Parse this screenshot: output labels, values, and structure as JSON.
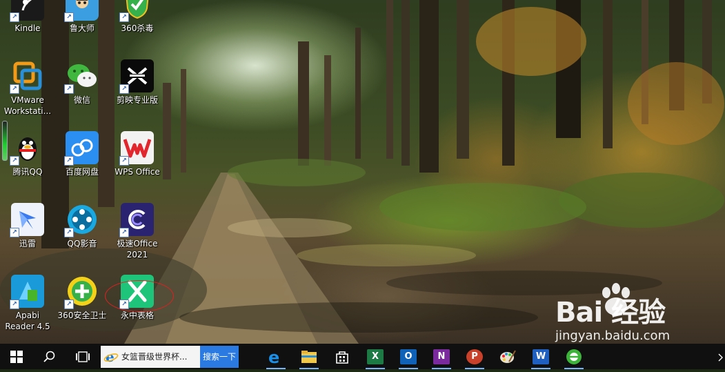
{
  "desktop": {
    "icons": [
      {
        "label": "Kindle"
      },
      {
        "label": "鲁大师"
      },
      {
        "label": "360杀毒"
      },
      {
        "label": "VMware Workstati..."
      },
      {
        "label": "微信"
      },
      {
        "label": "剪映专业版"
      },
      {
        "label": "腾讯QQ"
      },
      {
        "label": "百度网盘"
      },
      {
        "label": "WPS Office"
      },
      {
        "label": "迅雷"
      },
      {
        "label": "QQ影音"
      },
      {
        "label": "极速Office 2021"
      },
      {
        "label": "Apabi Reader 4.5"
      },
      {
        "label": "360安全卫士"
      },
      {
        "label": "永中表格"
      }
    ]
  },
  "taskbar": {
    "search": {
      "value": "女篮晋级世界杯...",
      "button_label": "搜索一下"
    },
    "pinned_apps": [
      "edge-icon",
      "file-explorer-icon",
      "store-icon",
      "excel-icon",
      "outlook-icon",
      "onenote-icon",
      "powerpoint-icon",
      "paint-icon",
      "word-icon",
      "360-browser-icon"
    ],
    "accent_color": "#2a7ae2"
  },
  "watermark": {
    "logo_text": "Bai 经验",
    "url": "jingyan.baidu.com"
  }
}
